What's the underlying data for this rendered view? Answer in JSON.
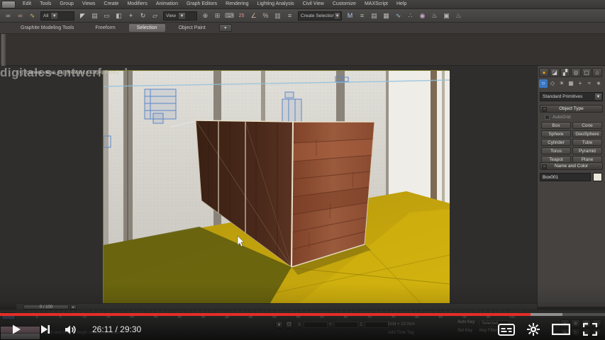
{
  "video_overlay": {
    "watermark": "digitales-entwerfen.de",
    "progress": {
      "played_fraction": 0.877,
      "buffered_fraction": 0.93,
      "played_color": "#e52d27"
    },
    "controls": {
      "play_icon": "play-triangle",
      "next_icon": "next-track",
      "volume_icon": "speaker",
      "time_display": "26:11 / 29:30",
      "cc_icon": "closed-captions",
      "settings_icon": "gear",
      "theater_icon": "theater-mode",
      "fullscreen_icon": "fullscreen"
    }
  },
  "max_ui": {
    "menubar": {
      "items": [
        "Edit",
        "Tools",
        "Group",
        "Views",
        "Create",
        "Modifiers",
        "Animation",
        "Graph Editors",
        "Rendering",
        "Lighting Analysis",
        "Civil View",
        "Customize",
        "MAXScript",
        "Help"
      ]
    },
    "toolbar": {
      "selection_filter_value": "All",
      "coord_system_value": "View",
      "named_sets_value": "Create Selection Set",
      "icons": [
        {
          "name": "select-and-link-icon",
          "glyph": "∞",
          "color": "#b8b8b6"
        },
        {
          "name": "unlink-selection-icon",
          "glyph": "∞",
          "color": "#c49a8a"
        },
        {
          "name": "bind-to-space-warp-icon",
          "glyph": "∿",
          "color": "#c8c26a"
        },
        {
          "name": "select-object-icon",
          "glyph": "◤",
          "color": "#c8c8c6"
        },
        {
          "name": "select-by-name-icon",
          "glyph": "▤",
          "color": "#b8b8b6"
        },
        {
          "name": "selection-region-icon",
          "glyph": "▭",
          "color": "#b8b8b6"
        },
        {
          "name": "window-crossing-icon",
          "glyph": "◧",
          "color": "#b8b8b6"
        },
        {
          "name": "select-and-move-icon",
          "glyph": "+",
          "color": "#d0d0ce"
        },
        {
          "name": "select-and-rotate-icon",
          "glyph": "↻",
          "color": "#c0c0be"
        },
        {
          "name": "select-and-scale-icon",
          "glyph": "▱",
          "color": "#c0c0be"
        },
        {
          "name": "use-pivot-center-icon",
          "glyph": "⊕",
          "color": "#b8b8b6"
        },
        {
          "name": "select-and-manipulate-icon",
          "glyph": "⊞",
          "color": "#b0b0ae"
        },
        {
          "name": "keyboard-override-icon",
          "glyph": "⌨",
          "color": "#b0b0ae"
        },
        {
          "name": "snaps-toggle-icon",
          "glyph": "25",
          "color": "#e09090"
        },
        {
          "name": "angle-snap-icon",
          "glyph": "∠",
          "color": "#c9b0a0"
        },
        {
          "name": "percent-snap-icon",
          "glyph": "%",
          "color": "#c9b0a0"
        },
        {
          "name": "spinner-snap-icon",
          "glyph": "▥",
          "color": "#b0b0ae"
        },
        {
          "name": "edit-named-sets-icon",
          "glyph": "≡",
          "color": "#b8b8b6"
        },
        {
          "name": "mirror-icon",
          "glyph": "M",
          "color": "#a9c4de"
        },
        {
          "name": "align-icon",
          "glyph": "≡",
          "color": "#9cc49c"
        },
        {
          "name": "layer-manager-icon",
          "glyph": "▤",
          "color": "#b8b8b6"
        },
        {
          "name": "ribbon-toggle-icon",
          "glyph": "▦",
          "color": "#b8b8b6"
        },
        {
          "name": "curve-editor-icon",
          "glyph": "∿",
          "color": "#9cc4d4"
        },
        {
          "name": "schematic-view-icon",
          "glyph": "∴",
          "color": "#b8b8b6"
        },
        {
          "name": "material-editor-icon",
          "glyph": "◉",
          "color": "#c9a9c9"
        },
        {
          "name": "render-setup-icon",
          "glyph": "♨",
          "color": "#c9c9c7"
        },
        {
          "name": "rendered-frame-icon",
          "glyph": "▣",
          "color": "#b8b8b6"
        },
        {
          "name": "render-production-icon",
          "glyph": "♨",
          "color": "#a9a9a7"
        }
      ]
    },
    "ribbon": {
      "tabs": [
        {
          "label": "Graphite Modeling Tools",
          "active": false
        },
        {
          "label": "Freeform",
          "active": false
        },
        {
          "label": "Selection",
          "active": true
        },
        {
          "label": "Object Paint",
          "active": false
        }
      ]
    },
    "viewport": {
      "label_pov": "[+]",
      "label_camera": "[camera_detail_01]",
      "label_shading": "[Realistic + Edged Faces]"
    },
    "timeline": {
      "slider_value": "0 / 100",
      "ruler_numbers": [
        0,
        5,
        10,
        15,
        20,
        25,
        30,
        35,
        40,
        45,
        50,
        55,
        60,
        65,
        70,
        75,
        80,
        85,
        90,
        95,
        100
      ]
    },
    "statusbar": {
      "coord_labels": [
        "X:",
        "Y:",
        "Z:"
      ],
      "grid_text": "Grid = 10.0cm",
      "time_tag_text": "Add Time Tag",
      "prompt_text": "Click and drag to begin creation process",
      "auto_key": "Auto Key",
      "set_key": "Set Key",
      "selected_value": "Selected",
      "key_filters": "Key Filters..."
    },
    "command_panel": {
      "tab_icons": [
        "create-tab-icon",
        "modify-tab-icon",
        "hierarchy-tab-icon",
        "motion-tab-icon",
        "display-tab-icon",
        "utilities-tab-icon"
      ],
      "category_icons": [
        "geometry-category-icon",
        "shapes-category-icon",
        "lights-category-icon",
        "cameras-category-icon",
        "helpers-category-icon",
        "spacewarps-category-icon",
        "systems-category-icon"
      ],
      "primitive_category_value": "Standard Primitives",
      "object_type_header": "Object Type",
      "autogrid_label": "AutoGrid",
      "object_buttons": [
        "Box",
        "Cone",
        "Sphere",
        "GeoSphere",
        "Cylinder",
        "Tube",
        "Torus",
        "Pyramid",
        "Teapot",
        "Plane"
      ],
      "name_color_header": "Name and Color",
      "object_name_value": "Box001"
    },
    "colors": {
      "safe_frame_border": "#7c7c30",
      "floor_yellow": "#b89a0c",
      "wood_bright": "#8a4a33",
      "wood_dark": "#45261a",
      "wireframe_blue": "#5b86c8",
      "active_category_blue": "#3a76c4"
    }
  }
}
